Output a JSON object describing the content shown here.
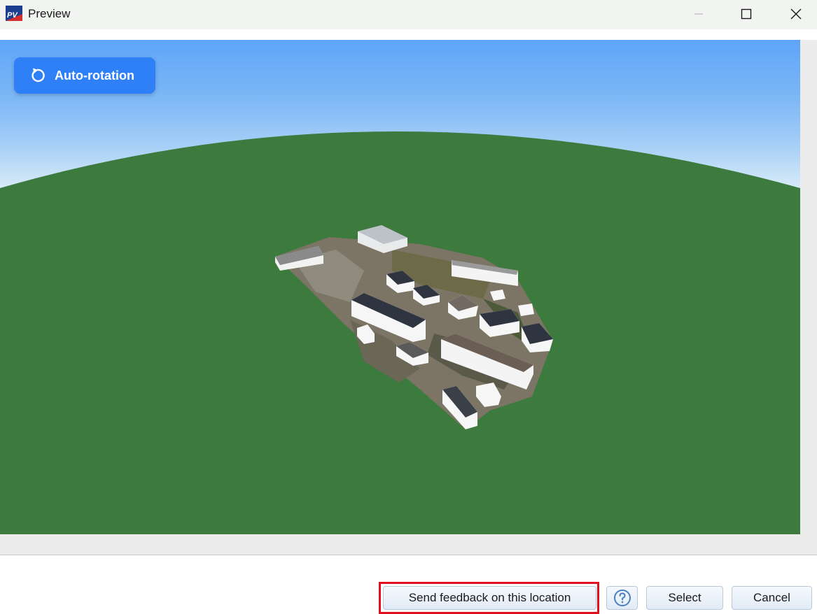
{
  "window": {
    "title": "Preview",
    "logo_text": "PV",
    "controls": {
      "minimize": "minimize-icon",
      "maximize": "maximize-icon",
      "close": "close-icon"
    }
  },
  "viewport": {
    "auto_rotation_label": "Auto-rotation",
    "auto_rotation_icon": "rotate-ccw-icon",
    "colors": {
      "sky_top": "#5ea5f8",
      "ground": "#3d7a3d",
      "button": "#2f7ff7"
    }
  },
  "footer": {
    "feedback_label": "Send feedback on this location",
    "help_icon": "help-icon",
    "select_label": "Select",
    "cancel_label": "Cancel",
    "highlight_color": "#e0101d"
  }
}
